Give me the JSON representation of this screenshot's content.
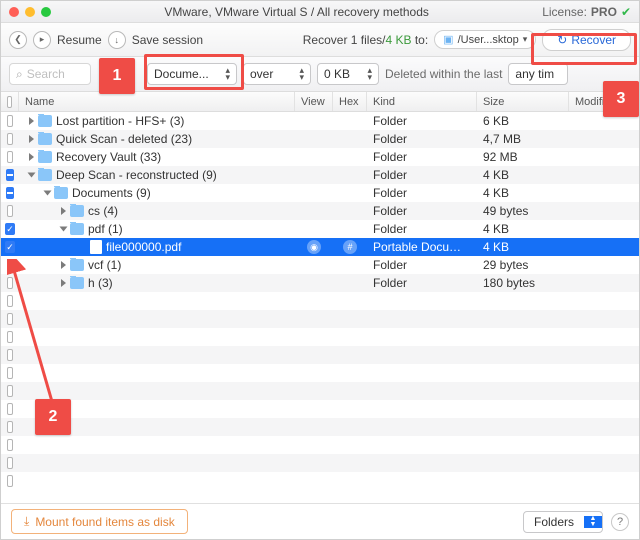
{
  "title": "VMware, VMware Virtual S / All recovery methods",
  "license": {
    "label": "License:",
    "tier": "PRO"
  },
  "toolbar": {
    "resume": "Resume",
    "save_session": "Save session",
    "stats_prefix": "Recover ",
    "stats_files": "1 files/",
    "stats_size": "4 KB",
    "stats_to": " to:",
    "dest_path": "/User...sktop",
    "recover": "Recover"
  },
  "filter": {
    "search_placeholder": "Search",
    "type_value": "Docume...",
    "match_mode": "over",
    "size_value": "0 KB",
    "deleted_label": "Deleted within the last",
    "deleted_window": "any tim"
  },
  "columns": {
    "name": "Name",
    "view": "View",
    "hex": "Hex",
    "kind": "Kind",
    "size": "Size",
    "mod": "Modification"
  },
  "rows": [
    {
      "indent": 0,
      "expand": "closed",
      "check": "empty",
      "icon": "folder",
      "name": "Lost partition - HFS+ (3)",
      "kind": "Folder",
      "size": "6 KB"
    },
    {
      "indent": 0,
      "expand": "closed",
      "check": "empty",
      "icon": "folder",
      "name": "Quick Scan - deleted (23)",
      "kind": "Folder",
      "size": "4,7 MB"
    },
    {
      "indent": 0,
      "expand": "closed",
      "check": "empty",
      "icon": "folder",
      "name": "Recovery Vault (33)",
      "kind": "Folder",
      "size": "92 MB"
    },
    {
      "indent": 0,
      "expand": "open",
      "check": "partial",
      "icon": "folder",
      "name": "Deep Scan - reconstructed (9)",
      "kind": "Folder",
      "size": "4 KB"
    },
    {
      "indent": 1,
      "expand": "open",
      "check": "partial",
      "icon": "folder",
      "name": "Documents (9)",
      "kind": "Folder",
      "size": "4 KB"
    },
    {
      "indent": 2,
      "expand": "closed",
      "check": "empty",
      "icon": "folder",
      "name": "cs (4)",
      "kind": "Folder",
      "size": "49 bytes"
    },
    {
      "indent": 2,
      "expand": "open",
      "check": "checked",
      "icon": "folder",
      "name": "pdf (1)",
      "kind": "Folder",
      "size": "4 KB"
    },
    {
      "indent": 3,
      "expand": "none",
      "check": "checked",
      "icon": "doc",
      "name": "file000000.pdf",
      "selected": true,
      "kind": "Portable Docume...",
      "size": "4 KB",
      "preview": true
    },
    {
      "indent": 2,
      "expand": "closed",
      "check": "empty",
      "icon": "folder",
      "name": "vcf (1)",
      "kind": "Folder",
      "size": "29 bytes"
    },
    {
      "indent": 2,
      "expand": "closed",
      "check": "empty",
      "icon": "folder",
      "name": "h (3)",
      "kind": "Folder",
      "size": "180 bytes"
    }
  ],
  "callouts": {
    "c1": "1",
    "c2": "2",
    "c3": "3"
  },
  "bottom": {
    "mount": "Mount found items as disk",
    "folders": "Folders"
  }
}
